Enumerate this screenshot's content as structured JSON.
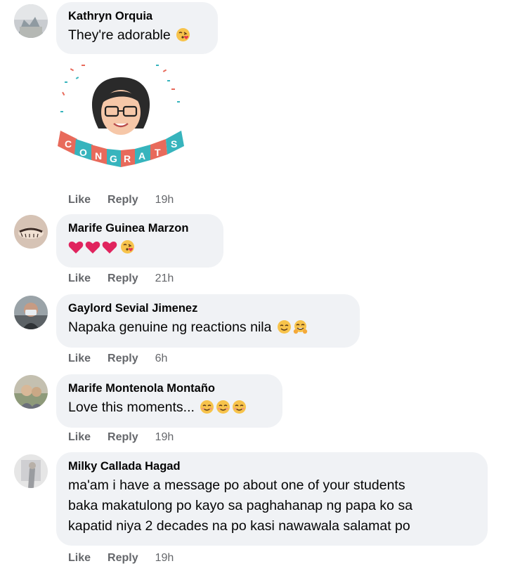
{
  "comments": [
    {
      "author": "Kathryn Orquia",
      "text": "They're adorable",
      "emoji": "kissing-heart",
      "sticker_text": "CONGRATS",
      "like": "Like",
      "reply": "Reply",
      "time": "19h"
    },
    {
      "author": "Marife Guinea Marzon",
      "text": "",
      "emoji": "hearts-and-kiss",
      "like": "Like",
      "reply": "Reply",
      "time": "21h"
    },
    {
      "author": "Gaylord Sevial Jimenez",
      "text": "Napaka genuine ng reactions nila",
      "emoji": "smile-and-hug",
      "like": "Like",
      "reply": "Reply",
      "time": "6h"
    },
    {
      "author": "Marife Montenola Montaño",
      "text": "Love this moments...",
      "emoji": "three-smiles",
      "like": "Like",
      "reply": "Reply",
      "time": "19h"
    },
    {
      "author": "Milky Callada Hagad",
      "lines": [
        "ma'am i have a message po about one of your students",
        "baka makatulong po kayo sa paghahanap ng papa ko sa",
        "kapatid niya 2 decades na po kasi nawawala salamat po"
      ],
      "like": "Like",
      "reply": "Reply",
      "time": "19h"
    }
  ],
  "colors": {
    "bubble": "#f0f2f5",
    "meta": "#65676b",
    "text": "#050505"
  }
}
